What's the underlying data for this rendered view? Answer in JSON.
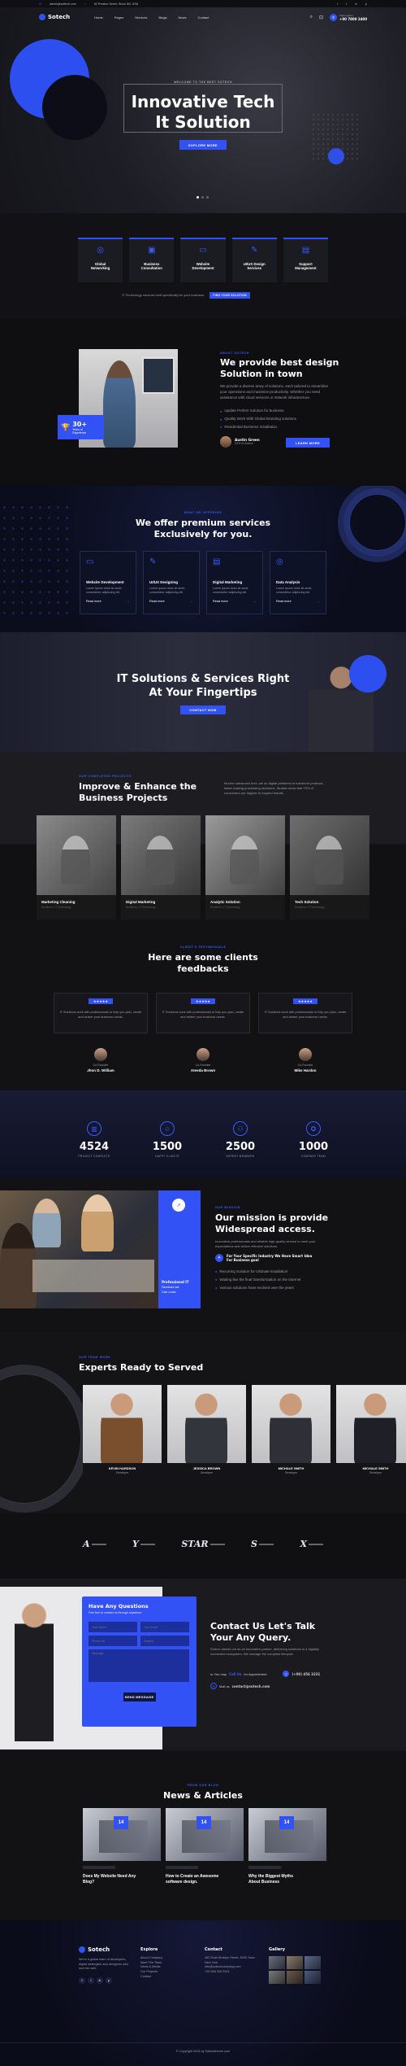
{
  "topbar": {
    "email": "admin@softech.com",
    "address": "82 Preston Street, Stock Hill, USA",
    "social": [
      "f",
      "t",
      "in",
      "p"
    ]
  },
  "nav": {
    "brand": "Sotech",
    "items": [
      "Home",
      "Pages",
      "Services",
      "Blogs",
      "News",
      "Contact"
    ],
    "phone_label": "Call Anytime",
    "phone": "+00 7800 2400"
  },
  "hero": {
    "tag": "WELCOME TO THE BEST SOTECH",
    "title_l1": "Innovative Tech",
    "title_l2": "It Solution",
    "button": "EXPLORE MORE"
  },
  "features": {
    "items": [
      {
        "title_l1": "Global",
        "title_l2": "Networking",
        "icon": "globe-icon"
      },
      {
        "title_l1": "Business",
        "title_l2": "Consultation",
        "icon": "briefcase-icon"
      },
      {
        "title_l1": "Website",
        "title_l2": "Development",
        "icon": "monitor-icon"
      },
      {
        "title_l1": "UI/UX Design",
        "title_l2": "Services",
        "icon": "design-icon"
      },
      {
        "title_l1": "Support",
        "title_l2": "Management",
        "icon": "chart-icon"
      }
    ],
    "note": "IT Technology services built specifically for your business.",
    "cta": "FIND YOUR SOLUTION"
  },
  "about": {
    "tag": "ABOUT SOTECH",
    "title_l1": "We provide best design",
    "title_l2": "Solution in town",
    "text": "We provide a diverse array of solutions, each tailored to streamline your operations and maximize productivity. Whether you need assistance with cloud services or network infrastructure.",
    "checks": [
      "Update Perfect Solution for business",
      "Quality Work With Global Branding solutions",
      "Residential Business Installation"
    ],
    "badge_num": "30+",
    "badge_l1": "Years of",
    "badge_l2": "Experience",
    "person_name": "Austin Green",
    "person_role": "CEO of Sotech",
    "button": "LEARN MORE"
  },
  "services": {
    "tag": "WHAT WE OFFERING",
    "title_l1": "We offer premium services",
    "title_l2": "Exclusively for you.",
    "items": [
      {
        "title": "Website Development",
        "text": "Lorem ipsum dolor sit amet, consectetur adipiscing elit.",
        "link": "Read more"
      },
      {
        "title": "UI/UX Designing",
        "text": "Lorem ipsum dolor sit amet, consectetur adipiscing elit.",
        "link": "Read more"
      },
      {
        "title": "Digital Marketing",
        "text": "Lorem ipsum dolor sit amet, consectetur adipiscing elit.",
        "link": "Read more"
      },
      {
        "title": "Data Analysis",
        "text": "Lorem ipsum dolor sit amet, consectetur adipiscing elit.",
        "link": "Read more"
      }
    ]
  },
  "banner": {
    "title_l1": "IT Solutions & Services Right",
    "title_l2": "At Your Fingertips",
    "button": "CONTACT NOW"
  },
  "projects": {
    "tag": "OUR COMPLETED PROJECTS",
    "title_l1": "Improve & Enhance the",
    "title_l2": "Business Projects",
    "text": "Modern advanced tech, we do digital platforms to transform products faster making purchasing decisions. Studies show that 70% of consumers are happier to expand brands.",
    "items": [
      {
        "title": "Marketing Cleaning",
        "sub": "Solutions / IT Technology"
      },
      {
        "title": "Digital Marketing",
        "sub": "Solutions / IT Technology"
      },
      {
        "title": "Analytic Solution",
        "sub": "Solutions / IT Technology"
      },
      {
        "title": "Tech Solution",
        "sub": "Solutions / IT Technology"
      }
    ]
  },
  "testimonials": {
    "tag": "CLIENT'S TESTIMONIALS",
    "title_l1": "Here are some clients",
    "title_l2": "feedbacks",
    "items": [
      {
        "stars": "★★★★★",
        "text": "IT Solutions work with professionals to help you plan, create and deliver your business needs.",
        "role": "Co-Founder",
        "name": "Jhon D. William"
      },
      {
        "stars": "★★★★★",
        "text": "IT Solutions work with professionals to help you plan, create and deliver your business needs.",
        "role": "Co-Founder",
        "name": "Ateeda Brown"
      },
      {
        "stars": "★★★★★",
        "text": "IT Solutions work with professionals to help you plan, create and deliver your business needs.",
        "role": "Co-Founder",
        "name": "Mike Hardon"
      }
    ]
  },
  "stats": {
    "items": [
      {
        "num": "4524",
        "label": "PROJECT COMPLETE",
        "icon": "folder-icon"
      },
      {
        "num": "1500",
        "label": "HAPPY CLIENTS",
        "icon": "user-icon"
      },
      {
        "num": "2500",
        "label": "EXPERT MEMBERS",
        "icon": "team-icon"
      },
      {
        "num": "1000",
        "label": "COMPANY TEAM",
        "icon": "award-icon"
      }
    ]
  },
  "mission": {
    "tag": "OUR MISSION",
    "title_l1": "Our mission is provide",
    "title_l2": "Widespread access.",
    "text": "Innovative professionals and reliable high-quality service to meet your expectations and deliver effective solutions.",
    "highlight_l1": "For Your Specific Industry We Have Smart Idea",
    "highlight_l2": "For Business goal",
    "checks": [
      "Recurring Solution for Ultimate installation",
      "Waiting like the final transformation on the Internet",
      "Various solutions have evolved over the years"
    ],
    "side_l1": "Professional IT",
    "side_l2": "Services we",
    "side_l3": "Can Lead"
  },
  "team": {
    "tag": "OUR TEAM WORK",
    "title": "Experts Ready to Served",
    "members": [
      {
        "name": "KEVIN HARDSON",
        "role": "Developer"
      },
      {
        "name": "JESSICA BROWN",
        "role": "Developer"
      },
      {
        "name": "MICHALE SMITH",
        "role": "Developer"
      },
      {
        "name": "MICHALE SMITH",
        "role": "Developer"
      }
    ]
  },
  "brands": {
    "items": [
      "A",
      "Y",
      "STAR",
      "S",
      "X"
    ]
  },
  "contact": {
    "form_title": "Have Any Questions",
    "form_sub": "Feel free to contact us through anywhere",
    "ph_name": "Your Name",
    "ph_email": "Your Email",
    "ph_phone": "Phone No",
    "ph_subject": "Subject",
    "ph_message": "Message",
    "button": "SEND MESSAGE",
    "title_l1": "Contact Us Let's Talk",
    "title_l2": "Your Any Query.",
    "text": "Sotech stands out as an innovative partner, delivering solutions in a digitally connected ecosystem. We manage the complete lifecycle.",
    "call_label": "or You may",
    "call_strong": "Call Us",
    "call_tail": "for Appointment",
    "phone": "(+00) 456 3231",
    "email_label": "Mail us",
    "email": "contact@sotech.com"
  },
  "news": {
    "tag": "FROM OUR BLOG",
    "title": "News & Articles",
    "items": [
      {
        "date": "14",
        "title_l1": "Does My Website Need Any",
        "title_l2": "Blog?"
      },
      {
        "date": "14",
        "title_l1": "How to Create an Awesome",
        "title_l2": "software design."
      },
      {
        "date": "14",
        "title_l1": "Why the Biggest Myths",
        "title_l2": "About Business"
      }
    ]
  },
  "footer": {
    "brand": "Sotech",
    "about": "We're a global team of developers, digital strategists and designers who love the web.",
    "explore_title": "Explore",
    "explore": [
      "About Company",
      "Meet The Team",
      "News & Media",
      "Our Projects",
      "Contact"
    ],
    "contact_title": "Contact",
    "contact": [
      "482 Road Broklyn Street, 8000 Town",
      "New York",
      "info@sotechcompany.com",
      "+00 456 345 3321"
    ],
    "gallery_title": "Gallery",
    "copyright": "© Copyright 2024 by Sotechtheme.com"
  },
  "colors": {
    "accent": "#3252f5",
    "bg": "#111114"
  }
}
